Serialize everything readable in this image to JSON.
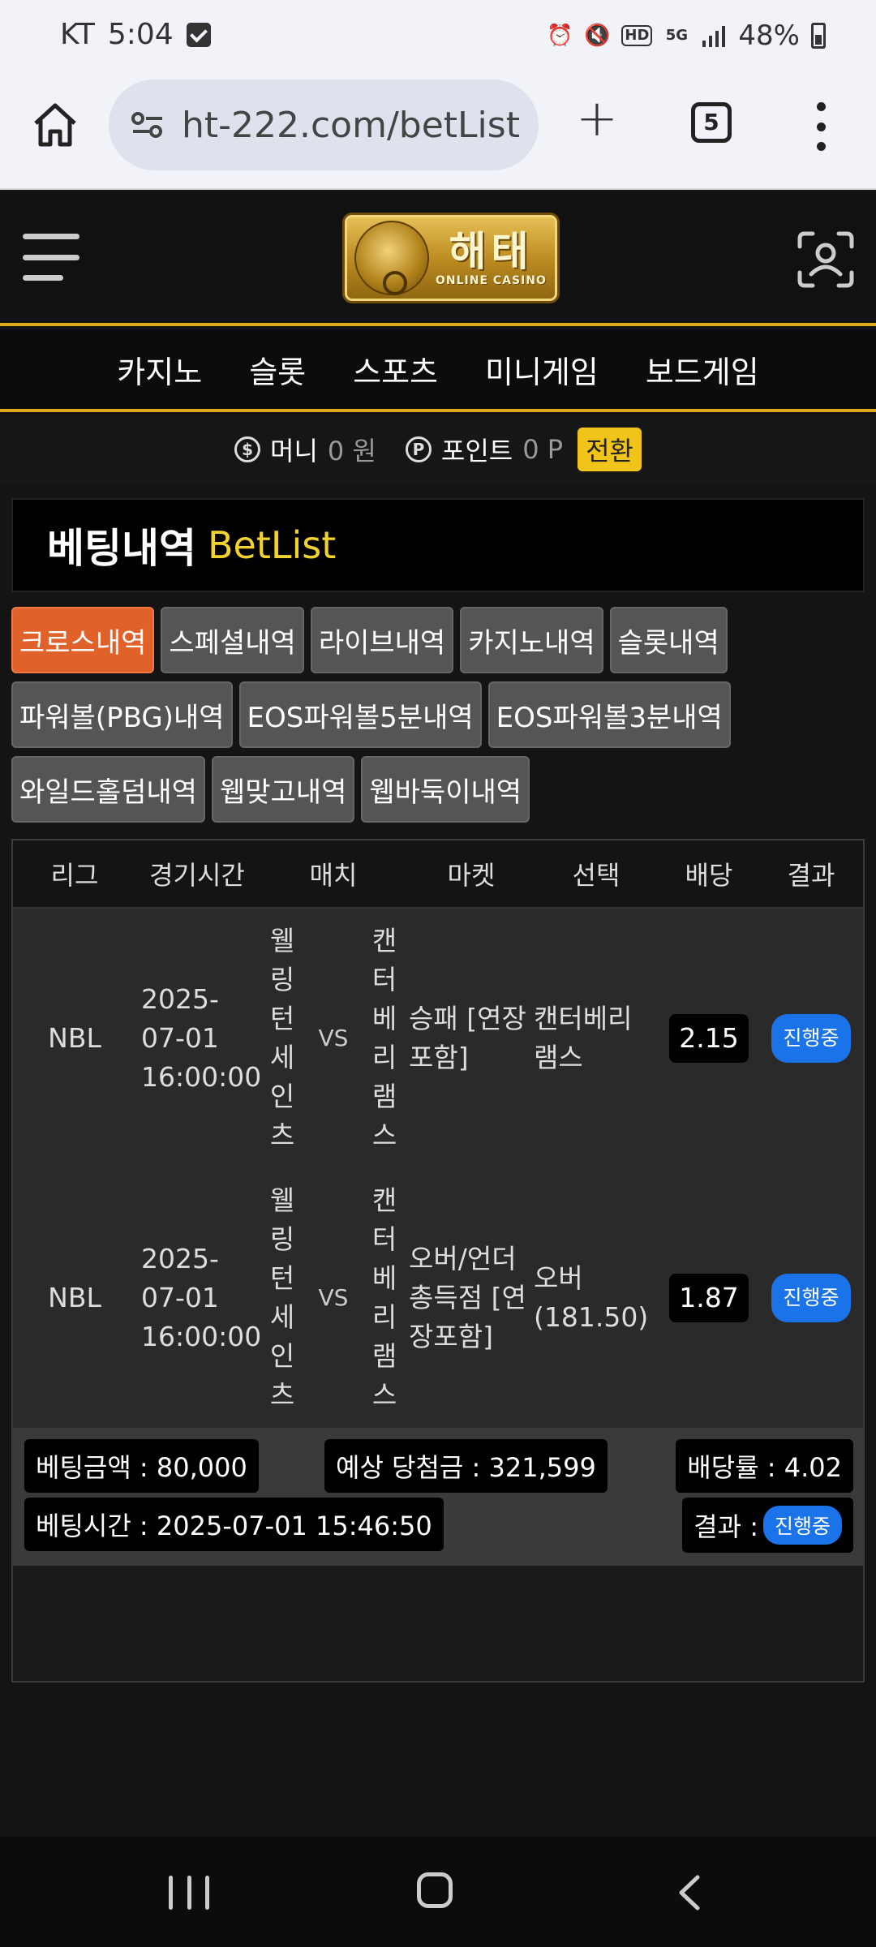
{
  "status_bar": {
    "carrier": "KT",
    "time": "5:04",
    "network": "5G",
    "battery": "48%"
  },
  "browser": {
    "url": "ht-222.com/betList",
    "tab_count": "5"
  },
  "site": {
    "logo_text": "해태",
    "logo_sub": "ONLINE CASINO"
  },
  "nav": {
    "items": [
      "카지노",
      "슬롯",
      "스포츠",
      "미니게임",
      "보드게임"
    ]
  },
  "money": {
    "coin_symbol": "$",
    "point_symbol": "P",
    "money_label": "머니",
    "money_value": "0 원",
    "point_label": "포인트",
    "point_value": "0 P",
    "switch_label": "전환"
  },
  "heading": {
    "ko": "베팅내역",
    "en": "BetList"
  },
  "tabs": [
    "크로스내역",
    "스페셜내역",
    "라이브내역",
    "카지노내역",
    "슬롯내역",
    "파워볼(PBG)내역",
    "EOS파워볼5분내역",
    "EOS파워볼3분내역",
    "와일드홀덤내역",
    "웹맞고내역",
    "웹바둑이내역"
  ],
  "active_tab": "크로스내역",
  "table": {
    "headers": [
      "리그",
      "경기시간",
      "매치",
      "마켓",
      "선택",
      "배당",
      "결과"
    ],
    "rows": [
      {
        "league": "NBL",
        "time_date": "2025-07-01",
        "time_clock": "16:00:00",
        "home": "웰링턴세인츠",
        "vs": "VS",
        "away": "캔터베리램스",
        "market": "승패 [연장포함]",
        "pick": "캔터베리램스",
        "odds": "2.15",
        "result": "진행중"
      },
      {
        "league": "NBL",
        "time_date": "2025-07-01",
        "time_clock": "16:00:00",
        "home": "웰링턴세인츠",
        "vs": "VS",
        "away": "캔터베리램스",
        "market": "오버/언더 총득점 [연장포함]",
        "pick": "오버 (181.50)",
        "odds": "1.87",
        "result": "진행중"
      }
    ]
  },
  "summary": {
    "bet_amount": "베팅금액 : 80,000",
    "expected_win": "예상 당첨금 : 321,599",
    "odds_rate": "배당률 : 4.02",
    "bet_time": "베팅시간 : 2025-07-01 15:46:50",
    "result_label": "결과 :",
    "result_status": "진행중"
  },
  "colors": {
    "gold": "#e0a91c",
    "active_tab": "#e0622a",
    "badge_blue": "#1a73e8",
    "heading_en": "#f2d22c"
  }
}
